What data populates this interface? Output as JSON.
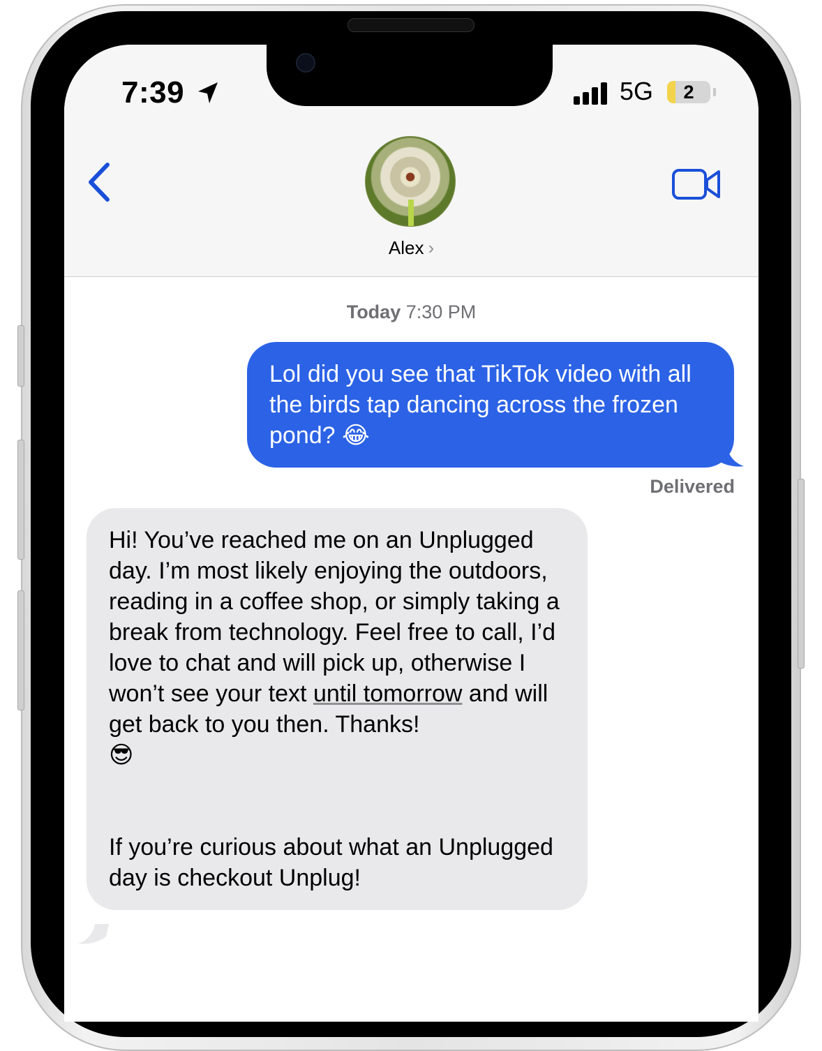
{
  "status_bar": {
    "time": "7:39",
    "network": "5G",
    "battery": "2",
    "icons": [
      "location-arrow-icon",
      "signal-bars-icon",
      "battery-icon"
    ]
  },
  "header": {
    "contact_name": "Alex",
    "contact_chevron": "›",
    "icons": [
      "back-chevron-icon",
      "dandelion-avatar",
      "video-camera-icon"
    ]
  },
  "conversation": {
    "timestamp_day": "Today",
    "timestamp_time": "7:30 PM",
    "outgoing": {
      "text": "Lol did you see that TikTok video with all the birds tap dancing across the frozen pond?",
      "emoji": "😂",
      "status": "Delivered"
    },
    "incoming": {
      "part1": "Hi! You’ve reached me on an Unplugged day. I’m most likely enjoying the outdoors, reading in a coffee shop, or simply taking a break from technology. Feel free to call, I’d love to chat and will pick up, otherwise I won’t see your text",
      "link": "until tomorrow",
      "part2": "and will get back to you then. Thanks!",
      "emoji": "😎",
      "part3": "If you’re curious about what an Unplugged day is checkout Unplug!"
    }
  },
  "colors": {
    "outgoing_bubble": "#2b62e6",
    "incoming_bubble": "#e9e9eb",
    "accent": "#1a4fd8"
  }
}
